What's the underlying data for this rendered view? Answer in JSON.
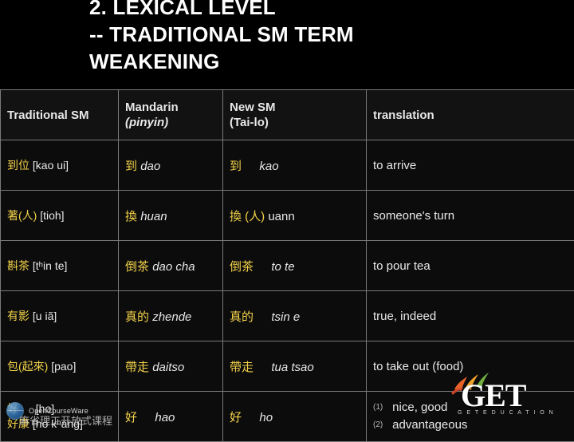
{
  "title": {
    "line1": "2. LEXICAL LEVEL",
    "line2": "-- TRADITIONAL SM TERM",
    "line3": "WEAKENING"
  },
  "table": {
    "headers": [
      {
        "line1": "Traditional SM",
        "line2": ""
      },
      {
        "line1": "Mandarin",
        "line2": "(pinyin)"
      },
      {
        "line1": "New SM",
        "line2": "(Tai-lo)"
      },
      {
        "line1": "translation",
        "line2": ""
      }
    ],
    "rows": [
      {
        "traditional_han": "到位",
        "traditional_ipa": "[kao ui]",
        "mandarin_han": "到",
        "mandarin_rom": "dao",
        "newsm_han": "到",
        "newsm_rom": "kao",
        "translation": "to arrive"
      },
      {
        "traditional_han": "著(人)",
        "traditional_ipa": "[tioh]",
        "mandarin_han": "換",
        "mandarin_rom": "huan",
        "newsm_han": "換 (人)",
        "newsm_rom": "uann",
        "translation": "someone's turn"
      },
      {
        "traditional_han": "斟茶",
        "traditional_ipa": "[tʰin te]",
        "mandarin_han": "倒茶",
        "mandarin_rom": "dao cha",
        "newsm_han": "倒茶",
        "newsm_rom": "to te",
        "translation": "to pour tea"
      },
      {
        "traditional_han": "有影",
        "traditional_ipa": "[u iã]",
        "mandarin_han": "真的",
        "mandarin_rom": "zhende",
        "newsm_han": "真的",
        "newsm_rom": "tsin e",
        "translation": "true, indeed"
      },
      {
        "traditional_han": "包(起來)",
        "traditional_ipa": "[pao]",
        "mandarin_han": "帶走",
        "mandarin_rom": "daitso",
        "newsm_han": "帶走",
        "newsm_rom": "tua tsao",
        "translation": "to take out (food)"
      },
      {
        "traditional_han": "好",
        "traditional_ipa": "[ho]",
        "traditional_han2": "好康",
        "traditional_ipa2": "[ho kʰang]",
        "mandarin_han": "好",
        "mandarin_rom": "hao",
        "newsm_han": "好",
        "newsm_rom": "ho",
        "translation_items": [
          {
            "num": "(1)",
            "text": "nice, good"
          },
          {
            "num": "(2)",
            "text": "advantageous"
          }
        ]
      }
    ]
  },
  "footer": {
    "ocw_label": "OpenCourseWare",
    "ocw_label_cn": "麻省理工开放式课程",
    "logo_word": "GET",
    "logo_sub": "G E T   E D U C A T I O N"
  },
  "colors": {
    "han_yellow": "#f3d24a",
    "text": "#e9e9e9",
    "border": "#7a7a7a",
    "background": "#000000"
  }
}
